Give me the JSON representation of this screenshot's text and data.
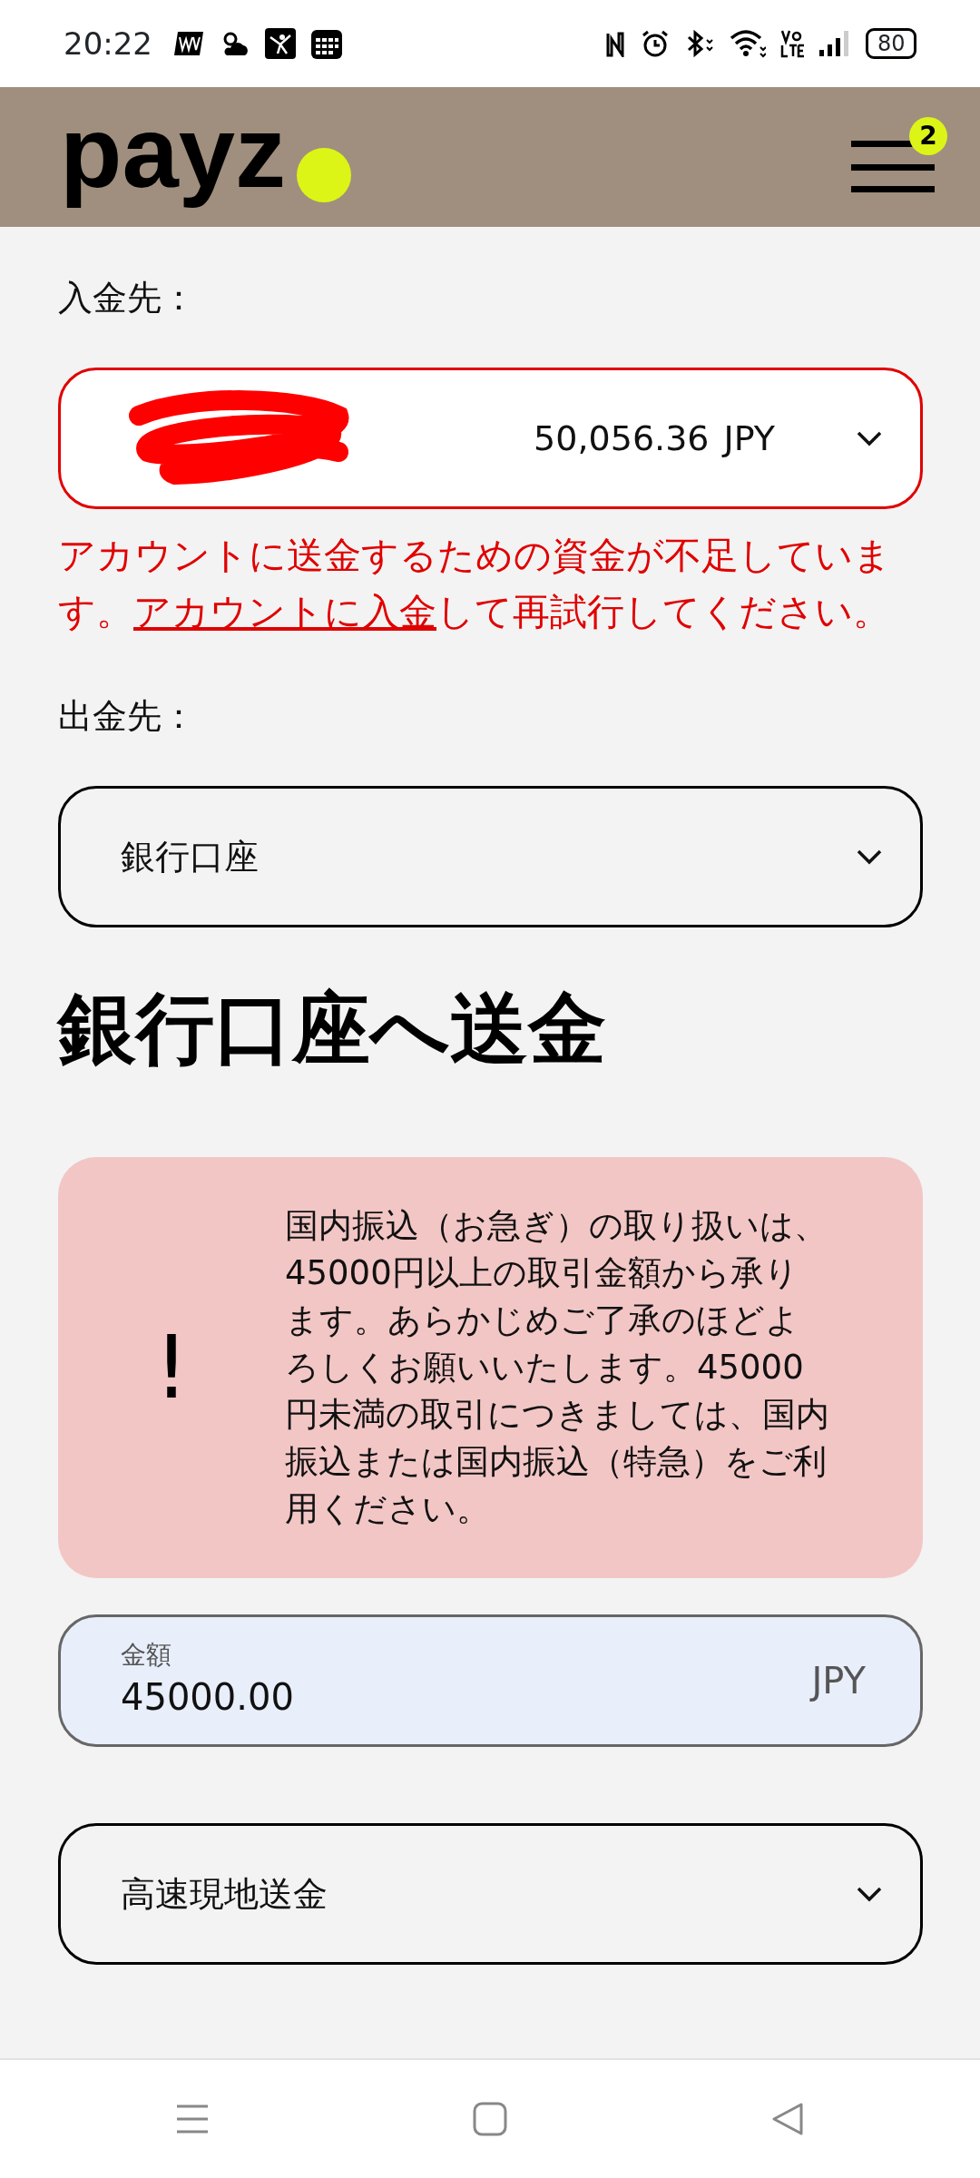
{
  "status_bar": {
    "time": "20:22",
    "battery": "80"
  },
  "header": {
    "logo": "payz",
    "notifications": "2"
  },
  "source": {
    "label": "入金先：",
    "amount": "50,056.36",
    "currency": "JPY",
    "error": true,
    "message_start": "アカウントに送金するための資金が不足しています。",
    "message_link": "アカウントに入金",
    "message_end": "して再試行してください。"
  },
  "destination": {
    "label": "出金先：",
    "value": "銀行口座"
  },
  "heading": "銀行口座へ送金",
  "notice": {
    "icon": "!",
    "text": "国内振込（お急ぎ）の取り扱いは、45000円以上の取引金額から承ります。あらかじめご了承のほどよろしくお願いいたします。45000円未満の取引につきましては、国内振込または国内振込（特急）をご利用ください。"
  },
  "amount": {
    "label": "金額",
    "value": "45000.00",
    "currency": "JPY"
  },
  "method": {
    "value": "高速現地送金"
  }
}
